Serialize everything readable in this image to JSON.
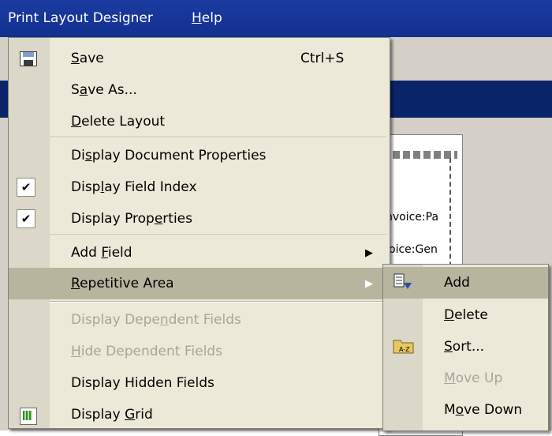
{
  "menubar": {
    "app_menu": "Print Layout Designer",
    "help_menu": "Help"
  },
  "background": {
    "snippet1": "nvoice:Pa",
    "snippet2": "oice:Gen"
  },
  "main_menu": {
    "save": {
      "label": "Save",
      "shortcut": "Ctrl+S"
    },
    "save_as": {
      "label": "Save As..."
    },
    "delete_layout": {
      "label": "Delete Layout"
    },
    "display_document_properties": {
      "label": "Display Document Properties"
    },
    "display_field_index": {
      "label": "Display Field Index",
      "checked": true
    },
    "display_properties": {
      "label": "Display Properties",
      "checked": true
    },
    "add_field": {
      "label": "Add Field"
    },
    "repetitive_area": {
      "label": "Repetitive Area"
    },
    "display_dependent_fields": {
      "label": "Display Dependent Fields",
      "enabled": false
    },
    "hide_dependent_fields": {
      "label": "Hide Dependent Fields",
      "enabled": false
    },
    "display_hidden_fields": {
      "label": "Display Hidden Fields"
    },
    "display_grid": {
      "label": "Display Grid"
    }
  },
  "sub_menu": {
    "add": {
      "label": "Add"
    },
    "delete": {
      "label": "Delete"
    },
    "sort": {
      "label": "Sort..."
    },
    "move_up": {
      "label": "Move Up",
      "enabled": false
    },
    "move_down": {
      "label": "Move Down"
    }
  },
  "colors": {
    "menubar_bg": "#12308f",
    "menu_bg": "#ece9d8",
    "highlight_bg": "#b8b59f",
    "disabled_text": "#a7a59c"
  },
  "icons": [
    "save-icon",
    "check-icon",
    "submenu-arrow-icon",
    "grid-icon",
    "add-row-icon",
    "sort-folder-icon"
  ]
}
